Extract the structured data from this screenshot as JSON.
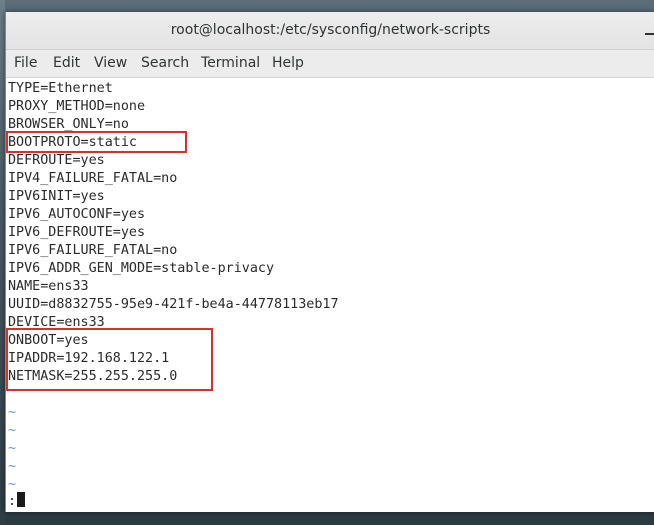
{
  "window": {
    "title": "root@localhost:/etc/sysconfig/network-scripts"
  },
  "menu": {
    "items": [
      {
        "label": "File"
      },
      {
        "label": "Edit"
      },
      {
        "label": "View"
      },
      {
        "label": "Search"
      },
      {
        "label": "Terminal"
      },
      {
        "label": "Help"
      }
    ]
  },
  "editor": {
    "lines": [
      "TYPE=Ethernet",
      "PROXY_METHOD=none",
      "BROWSER_ONLY=no",
      "BOOTPROTO=static",
      "DEFROUTE=yes",
      "IPV4_FAILURE_FATAL=no",
      "IPV6INIT=yes",
      "IPV6_AUTOCONF=yes",
      "IPV6_DEFROUTE=yes",
      "IPV6_FAILURE_FATAL=no",
      "IPV6_ADDR_GEN_MODE=stable-privacy",
      "NAME=ens33",
      "UUID=d8832755-95e9-421f-be4a-44778113eb17",
      "DEVICE=ens33",
      "ONBOOT=yes",
      "IPADDR=192.168.122.1",
      "NETMASK=255.255.255.0"
    ],
    "tildes": [
      "~",
      "~",
      "~",
      "~",
      "~"
    ],
    "command_prompt": ":",
    "highlight_color": "#d9302a"
  }
}
